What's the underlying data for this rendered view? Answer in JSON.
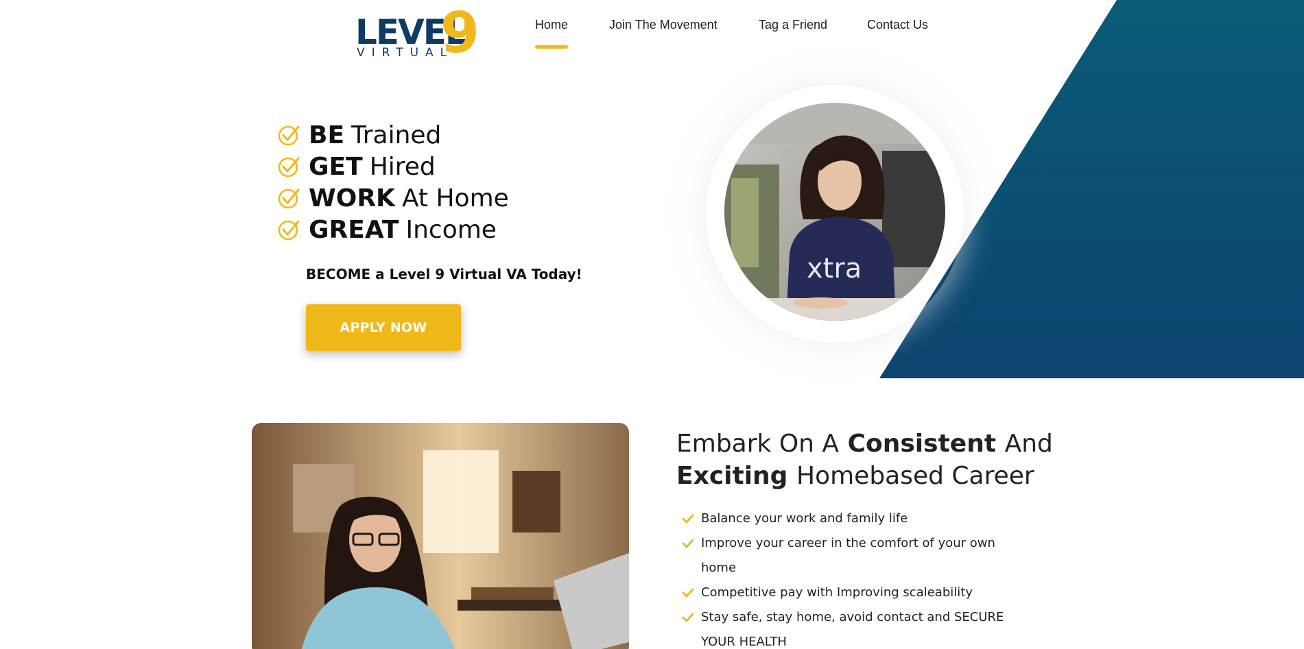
{
  "brand": {
    "logo_word": "LEVEL",
    "logo_number": "9",
    "logo_sub": "VIRTUAL",
    "navy": "#0e3b64",
    "yellow": "#f0b91b",
    "teal_dark": "#0a4d6e"
  },
  "nav": {
    "items": [
      {
        "label": "Home",
        "active": true
      },
      {
        "label": "Join The Movement",
        "active": false
      },
      {
        "label": "Tag a Friend",
        "active": false
      },
      {
        "label": "Contact Us",
        "active": false
      }
    ]
  },
  "hero": {
    "lines": [
      {
        "bold": "BE",
        "rest": "Trained"
      },
      {
        "bold": "GET",
        "rest": "Hired"
      },
      {
        "bold": "WORK",
        "rest": "At Home"
      },
      {
        "bold": "GREAT",
        "rest": "Income"
      }
    ],
    "check_icon": "circle-check-icon",
    "tagline": "BECOME a Level 9 Virtual VA Today!",
    "cta_label": "APPLY NOW",
    "photo_shirt_text": "xtra"
  },
  "section2": {
    "heading": {
      "p1": "Embark On A",
      "b1": "Consistent",
      "p2": "And",
      "b2": "Exciting",
      "p3": "Homebased Career"
    },
    "benefits": [
      "Balance your work and family life",
      "Improve your career in the comfort of your own home",
      "Competitive pay with Improving scaleability",
      "Stay safe, stay home, avoid contact and SECURE YOUR HEALTH"
    ],
    "tick_icon": "checkmark-icon"
  }
}
